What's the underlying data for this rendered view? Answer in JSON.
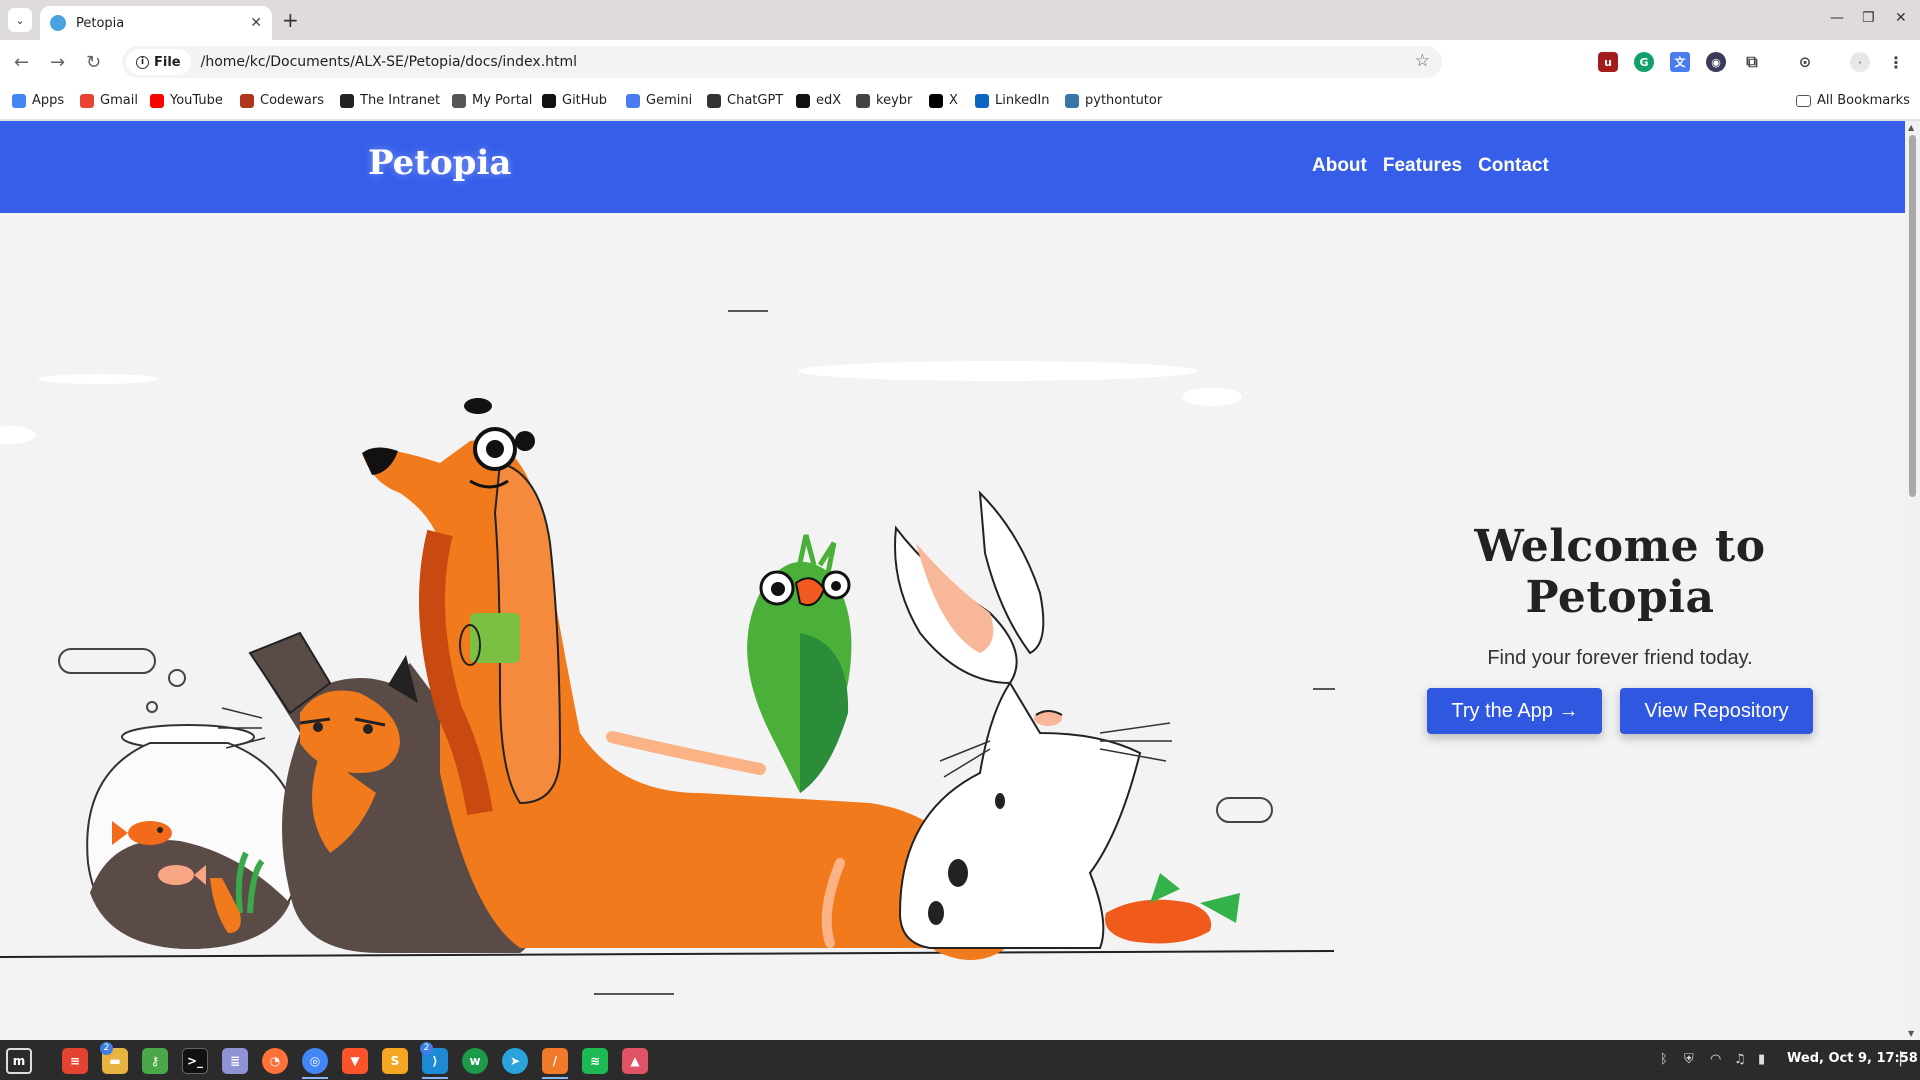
{
  "browser": {
    "tab_title": "Petopia",
    "url_chip": "File",
    "url": "/home/kc/Documents/ALX-SE/Petopia/docs/index.html",
    "bookmarks": [
      {
        "label": "Apps",
        "icon": "apps-grid-icon",
        "color": "#4285f4"
      },
      {
        "label": "Gmail",
        "icon": "gmail-icon",
        "color": "#ea4335"
      },
      {
        "label": "YouTube",
        "icon": "youtube-icon",
        "color": "#ff0000"
      },
      {
        "label": "Codewars",
        "icon": "codewars-icon",
        "color": "#b1361e"
      },
      {
        "label": "The Intranet",
        "icon": "alx-icon",
        "color": "#222222"
      },
      {
        "label": "My Portal",
        "icon": "portal-icon",
        "color": "#555555"
      },
      {
        "label": "GitHub",
        "icon": "github-icon",
        "color": "#111111"
      },
      {
        "label": "Gemini",
        "icon": "gemini-icon",
        "color": "#4a7cf0"
      },
      {
        "label": "ChatGPT",
        "icon": "chatgpt-icon",
        "color": "#333333"
      },
      {
        "label": "edX",
        "icon": "edx-icon",
        "color": "#111111"
      },
      {
        "label": "keybr",
        "icon": "keybr-icon",
        "color": "#444444"
      },
      {
        "label": "X",
        "icon": "x-icon",
        "color": "#000000"
      },
      {
        "label": "LinkedIn",
        "icon": "linkedin-icon",
        "color": "#0a66c2"
      },
      {
        "label": "pythontutor",
        "icon": "python-icon",
        "color": "#3776ab"
      }
    ],
    "all_bookmarks": "All Bookmarks"
  },
  "site": {
    "logo": "Petopia",
    "nav": [
      "About",
      "Features",
      "Contact"
    ],
    "hero_title": "Welcome to Petopia",
    "hero_subtitle": "Find your forever friend today.",
    "btn_try": "Try the App →",
    "btn_repo": "View Repository",
    "colors": {
      "header": "#365ee9",
      "button": "#2f57e0",
      "background": "#f3f3f3"
    }
  },
  "taskbar": {
    "clock": "Wed, Oct 9, 17:58",
    "badges": {
      "files": "2",
      "vscode": "2"
    }
  }
}
